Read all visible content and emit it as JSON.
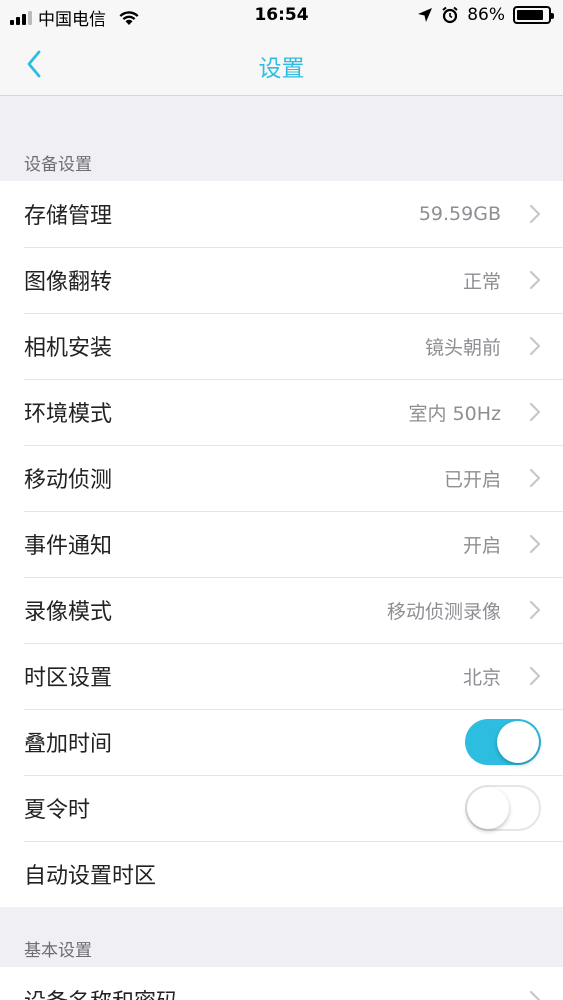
{
  "status_bar": {
    "carrier": "中国电信",
    "time": "16:54",
    "battery_percent": "86%",
    "battery_level": 0.86
  },
  "nav": {
    "title": "设置"
  },
  "device_section": {
    "header": "设备设置",
    "rows": [
      {
        "label": "存储管理",
        "value": "59.59GB"
      },
      {
        "label": "图像翻转",
        "value": "正常"
      },
      {
        "label": "相机安装",
        "value": "镜头朝前"
      },
      {
        "label": "环境模式",
        "value": "室内 50Hz"
      },
      {
        "label": "移动侦测",
        "value": "已开启"
      },
      {
        "label": "事件通知",
        "value": "开启"
      },
      {
        "label": "录像模式",
        "value": "移动侦测录像"
      },
      {
        "label": "时区设置",
        "value": "北京"
      }
    ],
    "overlay_time": {
      "label": "叠加时间",
      "enabled": true
    },
    "dst": {
      "label": "夏令时",
      "enabled": false
    },
    "auto_timezone": {
      "label": "自动设置时区"
    }
  },
  "basic_section": {
    "header": "基本设置",
    "rows": [
      {
        "label": "设备名称和密码"
      }
    ]
  },
  "colors": {
    "accent": "#2cbde0",
    "background": "#efeff4"
  }
}
